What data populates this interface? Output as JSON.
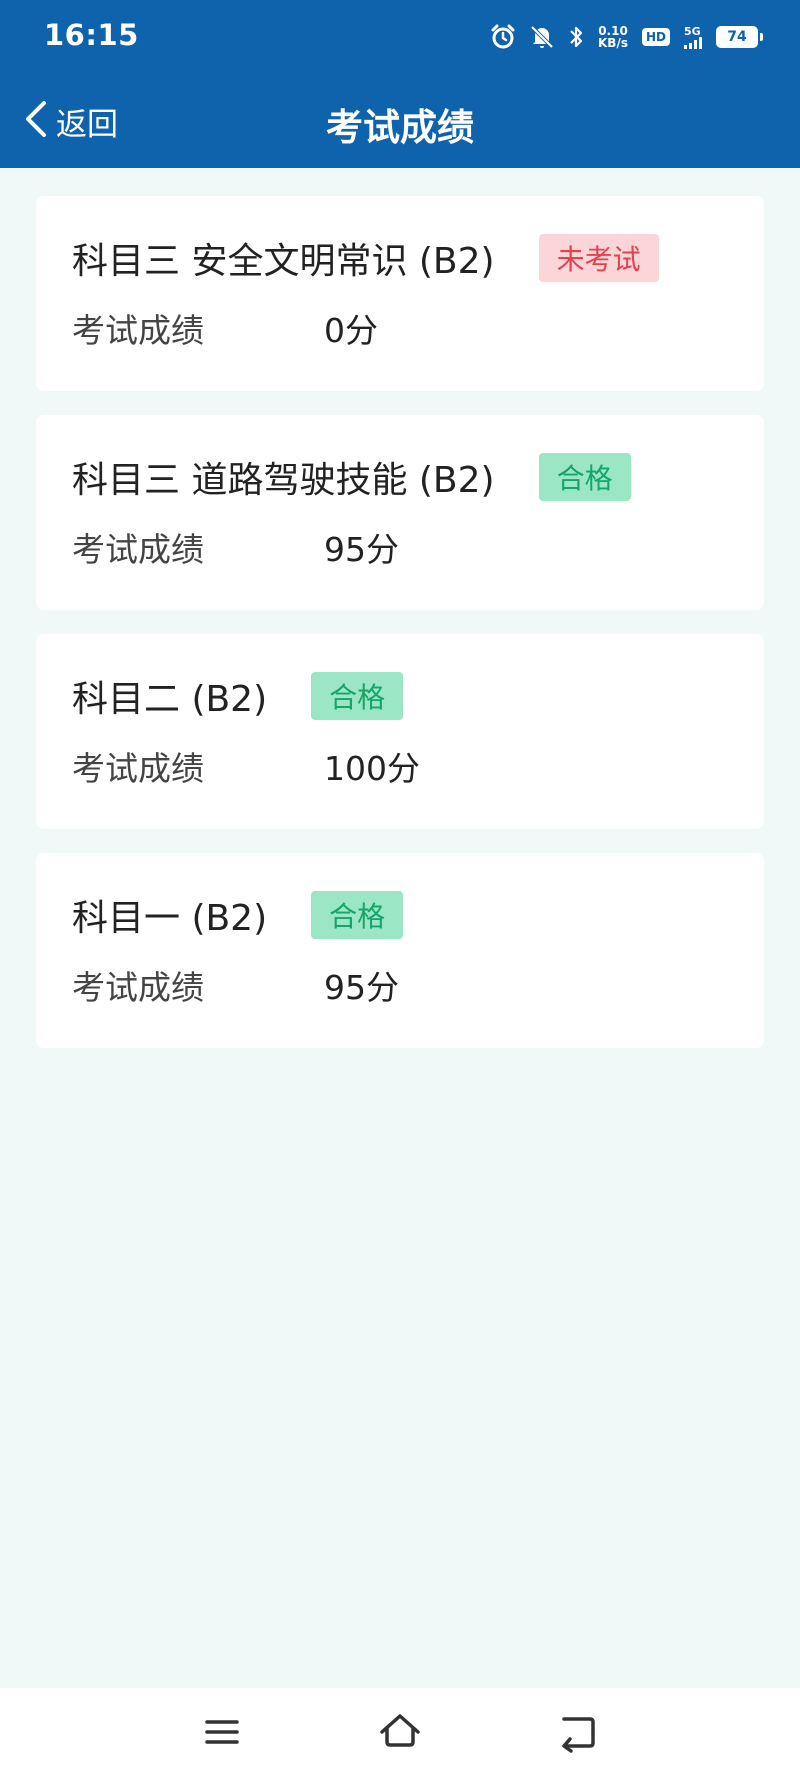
{
  "status": {
    "time": "16:15",
    "net_speed_value": "0.10",
    "net_speed_unit": "KB/s",
    "hd": "HD",
    "network": "5G",
    "battery": "74"
  },
  "header": {
    "back_label": "返回",
    "title": "考试成绩"
  },
  "exams": [
    {
      "subject": "科目三 安全文明常识 (B2)",
      "status": "未考试",
      "status_type": "fail",
      "score_label": "考试成绩",
      "score": "0分"
    },
    {
      "subject": "科目三 道路驾驶技能 (B2)",
      "status": "合格",
      "status_type": "pass",
      "score_label": "考试成绩",
      "score": "95分"
    },
    {
      "subject": "科目二 (B2)",
      "status": "合格",
      "status_type": "pass",
      "score_label": "考试成绩",
      "score": "100分"
    },
    {
      "subject": "科目一 (B2)",
      "status": "合格",
      "status_type": "pass",
      "score_label": "考试成绩",
      "score": "95分"
    }
  ],
  "colors": {
    "header_bg": "#0f63ac",
    "page_bg": "#f1f8f8",
    "fail_bg": "#fbd5d8",
    "fail_text": "#e0434e",
    "pass_bg": "#9be6c4",
    "pass_text": "#16a567"
  },
  "icons": [
    "alarm-icon",
    "mute-bell-icon",
    "bluetooth-icon",
    "battery-icon",
    "back-chevron-icon",
    "menu-icon",
    "home-icon",
    "back-nav-icon"
  ]
}
